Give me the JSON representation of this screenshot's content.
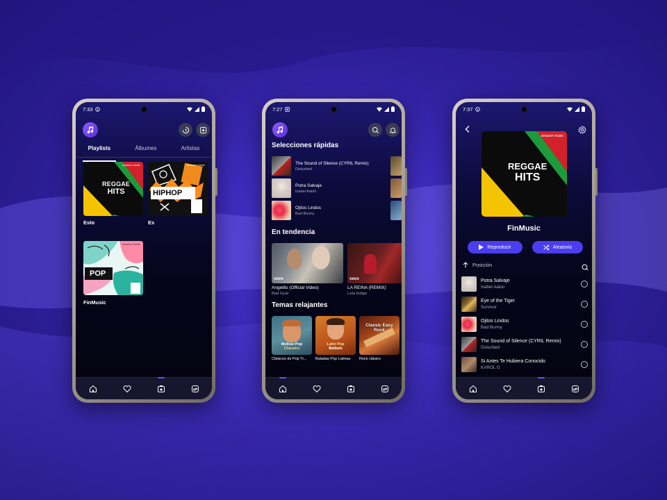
{
  "phone1": {
    "status_time": "7:33",
    "tabs": [
      "Playlists",
      "Álbumes",
      "Artistas"
    ],
    "tiles": [
      {
        "label": "Esto",
        "art_text_1": "REGGAE",
        "art_text_2": "HITS",
        "art_brand": "amazon music"
      },
      {
        "label": "Es",
        "art_text_1": "HIPHOP",
        "art_brand": "amazon music"
      },
      {
        "label": "FinMusic",
        "art_text_1": "POP",
        "art_brand": "amazon music"
      }
    ]
  },
  "phone2": {
    "status_time": "7:27",
    "quick_title": "Selecciones rápidas",
    "quick_picks": [
      {
        "title": "The Sound of Silence (CYRIL Remix)",
        "artist": "Disturbed"
      },
      {
        "title": "Potra Salvaje",
        "artist": "Isabel Aaiún"
      },
      {
        "title": "Ojitos Lindos",
        "artist": "Bad Bunny"
      }
    ],
    "trending_title": "En tendencia",
    "trending": [
      {
        "title": "Angelito (Official Video)",
        "artist": "Bad Gyal",
        "badge": "vevo"
      },
      {
        "title": "LA REINA (REMIX)",
        "artist": "Lola Indigo",
        "badge": "vevo"
      }
    ],
    "relax_title": "Temas relajantes",
    "relax": [
      {
        "label": "Clásicos de Pop Tr...",
        "art_text_1": "Mellow Pop",
        "art_text_2": "Classics"
      },
      {
        "label": "Baladas Pop Latinas",
        "art_text_1": "Latin Pop",
        "art_text_2": "Ballads"
      },
      {
        "label": "Rock clásico",
        "art_text_1": "Classic Easy",
        "art_text_2": "Rock"
      }
    ]
  },
  "phone3": {
    "status_time": "7:37",
    "cover_text_1": "REGGAE",
    "cover_text_2": "HITS",
    "cover_brand": "amazon music",
    "playlist_title": "FinMusic",
    "play_label": "Reproducir",
    "shuffle_label": "Aleatorio",
    "sort_label": "Posición",
    "songs": [
      {
        "title": "Potra Salvaje",
        "artist": "Isabel Aaiún"
      },
      {
        "title": "Eye of the Tiger",
        "artist": "Survivor"
      },
      {
        "title": "Ojitos Lindos",
        "artist": "Bad Bunny"
      },
      {
        "title": "The Sound of Silence (CYRIL Remix)",
        "artist": "Disturbed"
      },
      {
        "title": "Si Antes Te Hubiera Conocido",
        "artist": "KAROL G"
      }
    ]
  },
  "colors": {
    "accent": "#4b3df0",
    "background": "#2e1f9a"
  }
}
